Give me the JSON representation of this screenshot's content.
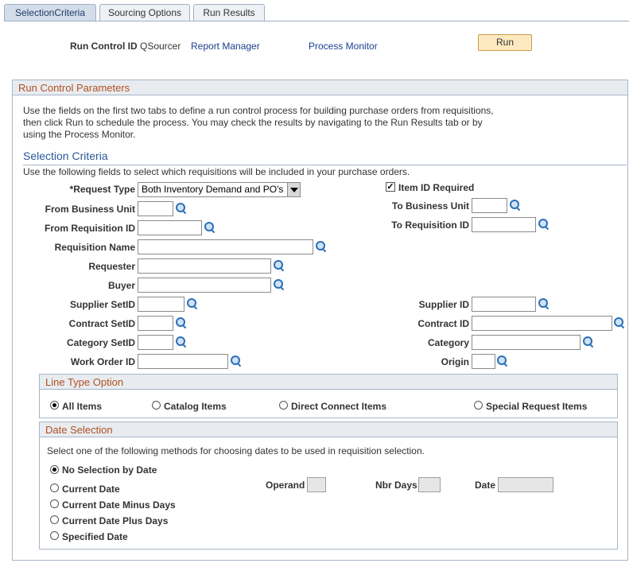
{
  "tabs": [
    {
      "label": "SelectionCriteria"
    },
    {
      "label": "Sourcing Options"
    },
    {
      "label": "Run Results"
    }
  ],
  "header": {
    "run_control_label": "Run Control ID",
    "run_control_value": "QSourcer",
    "report_manager": "Report Manager",
    "process_monitor": "Process Monitor",
    "run_button": "Run"
  },
  "params": {
    "title": "Run Control Parameters",
    "instructions_line1": "Use the fields on the first two tabs to define a run control process for building purchase orders from requisitions,",
    "instructions_line2": "then click Run to schedule the process. You may check the results by navigating to the Run Results tab or by",
    "instructions_line3": "using the Process Monitor."
  },
  "selection": {
    "title": "Selection Criteria",
    "description": "Use the following fields to select which requisitions will be included in your purchase orders.",
    "request_type_label": "*Request Type",
    "request_type_value": "Both Inventory Demand and PO's",
    "item_id_required_label": "Item ID Required",
    "item_id_required_checked": true,
    "from_bu_label": "From Business Unit",
    "to_bu_label": "To Business Unit",
    "from_req_label": "From Requisition ID",
    "to_req_label": "To Requisition ID",
    "req_name_label": "Requisition Name",
    "requester_label": "Requester",
    "buyer_label": "Buyer",
    "supplier_setid_label": "Supplier SetID",
    "supplier_id_label": "Supplier ID",
    "contract_setid_label": "Contract SetID",
    "contract_id_label": "Contract ID",
    "category_setid_label": "Category SetID",
    "category_label": "Category",
    "work_order_label": "Work Order ID",
    "origin_label": "Origin"
  },
  "line_type": {
    "title": "Line Type Option",
    "options": [
      "All Items",
      "Catalog Items",
      "Direct Connect Items",
      "Special Request Items"
    ],
    "selected": "All Items"
  },
  "date_selection": {
    "title": "Date Selection",
    "description": "Select one of the following methods for choosing dates to be used in requisition selection.",
    "options": [
      "No Selection by Date",
      "Current Date",
      "Current Date Minus Days",
      "Current Date Plus Days",
      "Specified Date"
    ],
    "selected": "No Selection by Date",
    "operand_label": "Operand",
    "nbr_days_label": "Nbr Days",
    "date_label": "Date"
  }
}
